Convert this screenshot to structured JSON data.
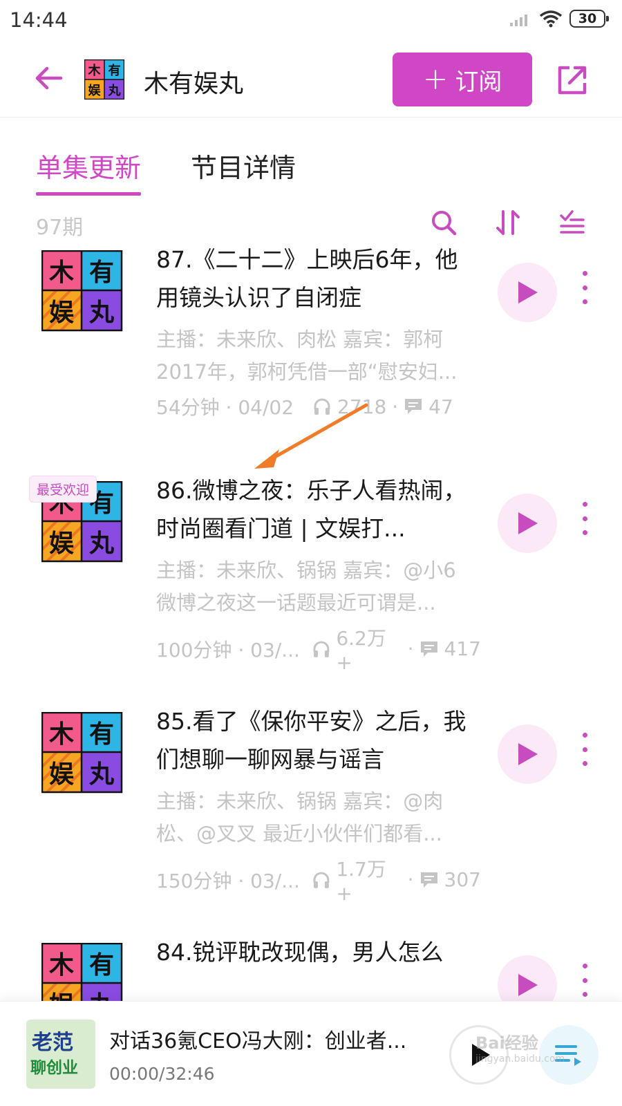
{
  "status_bar": {
    "time": "14:44",
    "battery": "30"
  },
  "header": {
    "title": "木有娱丸",
    "subscribe_label": "订阅",
    "logo_chars": [
      "木",
      "有",
      "娱",
      "丸"
    ]
  },
  "tabs": [
    {
      "label": "单集更新",
      "active": true
    },
    {
      "label": "节目详情",
      "active": false
    }
  ],
  "list": {
    "episode_count": "97期"
  },
  "episodes": [
    {
      "title": "87.《二十二》上映后6年，他用镜头认识了自闭症",
      "desc_line1": "主播：未来欣、肉松 嘉宾：郭柯",
      "desc_line2": "2017年，郭柯凭借一部“慰安妇...",
      "duration_date": "54分钟 · 04/02",
      "plays": "2718",
      "comments": "47",
      "badge": ""
    },
    {
      "title": "86.微博之夜：乐子人看热闹，时尚圈看门道 | 文娱打...",
      "desc_line1": "主播：未来欣、锅锅 嘉宾：@小6",
      "desc_line2": "微博之夜这一话题最近可谓是...",
      "duration_date": "100分钟 · 03/...",
      "plays": "6.2万+",
      "comments": "417",
      "badge": "最受欢迎"
    },
    {
      "title": "85.看了《保你平安》之后，我们想聊一聊网暴与谣言",
      "desc_line1": "主播：未来欣、锅锅 嘉宾：@肉",
      "desc_line2": "松、@叉叉 最近小伙伴们都看...",
      "duration_date": "150分钟 · 03/...",
      "plays": "1.7万+",
      "comments": "307",
      "badge": ""
    },
    {
      "title": "84.锐评耽改现偶，男人怎么",
      "desc_line1": "",
      "desc_line2": "",
      "duration_date": "",
      "plays": "",
      "comments": "",
      "badge": ""
    }
  ],
  "mini_player": {
    "title": "对话36氪CEO冯大刚：创业者...",
    "time": "00:00/32:46",
    "cover_line1": "老范",
    "cover_line2": "聊创业"
  },
  "watermark": {
    "line1": "Bai经验",
    "line2": "jingyan.baidu.com"
  },
  "colors": {
    "accent": "#d047c6",
    "muted": "#c4c4c4",
    "cover_pink": "#f25a8c",
    "cover_cyan": "#2fb4e6",
    "cover_orange": "#f7a623",
    "cover_purple": "#8a4be0",
    "arrow": "#f07c2a"
  },
  "icons": [
    "back-arrow-icon",
    "share-icon",
    "search-icon",
    "sort-icon",
    "multi-select-icon",
    "headphones-icon",
    "comment-icon",
    "play-icon",
    "more-vertical-icon",
    "playlist-icon"
  ]
}
